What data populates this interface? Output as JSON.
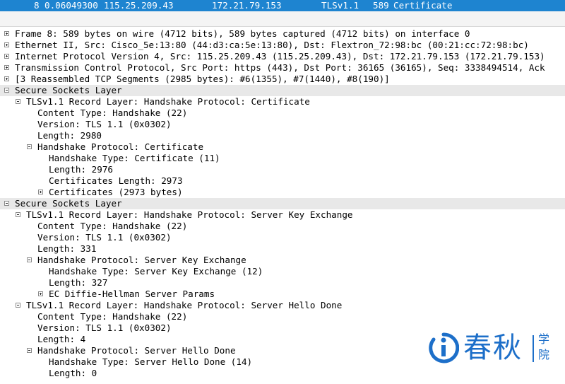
{
  "packet_row": {
    "no": "8",
    "time": "0.06049300",
    "source": "115.25.209.43",
    "destination": "172.21.79.153",
    "protocol": "TLSv1.1",
    "length": "589",
    "info": "Certificate"
  },
  "tree": [
    {
      "text": "Frame 8: 589 bytes on wire (4712 bits), 589 bytes captured (4712 bits) on interface 0",
      "level": 0,
      "expander": "plus"
    },
    {
      "text": "Ethernet II, Src: Cisco_5e:13:80 (44:d3:ca:5e:13:80), Dst: Flextron_72:98:bc (00:21:cc:72:98:bc)",
      "level": 0,
      "expander": "plus"
    },
    {
      "text": "Internet Protocol Version 4, Src: 115.25.209.43 (115.25.209.43), Dst: 172.21.79.153 (172.21.79.153)",
      "level": 0,
      "expander": "plus"
    },
    {
      "text": "Transmission Control Protocol, Src Port: https (443), Dst Port: 36165 (36165), Seq: 3338494514, Ack",
      "level": 0,
      "expander": "plus"
    },
    {
      "text": "[3 Reassembled TCP Segments (2985 bytes): #6(1355), #7(1440), #8(190)]",
      "level": 0,
      "expander": "plus"
    },
    {
      "text": "Secure Sockets Layer",
      "level": 0,
      "expander": "minus",
      "section": true
    },
    {
      "text": "TLSv1.1 Record Layer: Handshake Protocol: Certificate",
      "level": 1,
      "expander": "minus"
    },
    {
      "text": "Content Type: Handshake (22)",
      "level": 2,
      "expander": null
    },
    {
      "text": "Version: TLS 1.1 (0x0302)",
      "level": 2,
      "expander": null
    },
    {
      "text": "Length: 2980",
      "level": 2,
      "expander": null
    },
    {
      "text": "Handshake Protocol: Certificate",
      "level": 2,
      "expander": "minus"
    },
    {
      "text": "Handshake Type: Certificate (11)",
      "level": 3,
      "expander": null
    },
    {
      "text": "Length: 2976",
      "level": 3,
      "expander": null
    },
    {
      "text": "Certificates Length: 2973",
      "level": 3,
      "expander": null
    },
    {
      "text": "Certificates (2973 bytes)",
      "level": 3,
      "expander": "plus"
    },
    {
      "text": "Secure Sockets Layer",
      "level": 0,
      "expander": "minus",
      "section": true
    },
    {
      "text": "TLSv1.1 Record Layer: Handshake Protocol: Server Key Exchange",
      "level": 1,
      "expander": "minus"
    },
    {
      "text": "Content Type: Handshake (22)",
      "level": 2,
      "expander": null
    },
    {
      "text": "Version: TLS 1.1 (0x0302)",
      "level": 2,
      "expander": null
    },
    {
      "text": "Length: 331",
      "level": 2,
      "expander": null
    },
    {
      "text": "Handshake Protocol: Server Key Exchange",
      "level": 2,
      "expander": "minus"
    },
    {
      "text": "Handshake Type: Server Key Exchange (12)",
      "level": 3,
      "expander": null
    },
    {
      "text": "Length: 327",
      "level": 3,
      "expander": null
    },
    {
      "text": "EC Diffie-Hellman Server Params",
      "level": 3,
      "expander": "plus"
    },
    {
      "text": "TLSv1.1 Record Layer: Handshake Protocol: Server Hello Done",
      "level": 1,
      "expander": "minus"
    },
    {
      "text": "Content Type: Handshake (22)",
      "level": 2,
      "expander": null
    },
    {
      "text": "Version: TLS 1.1 (0x0302)",
      "level": 2,
      "expander": null
    },
    {
      "text": "Length: 4",
      "level": 2,
      "expander": null
    },
    {
      "text": "Handshake Protocol: Server Hello Done",
      "level": 2,
      "expander": "minus"
    },
    {
      "text": "Handshake Type: Server Hello Done (14)",
      "level": 3,
      "expander": null
    },
    {
      "text": "Length: 0",
      "level": 3,
      "expander": null
    }
  ],
  "watermark": {
    "name": "春秋",
    "suffix_1": "学",
    "suffix_2": "院",
    "color": "#1d6fc9"
  },
  "colors": {
    "selected_row": "#1e84d0",
    "section_row": "#e8e8e8"
  }
}
